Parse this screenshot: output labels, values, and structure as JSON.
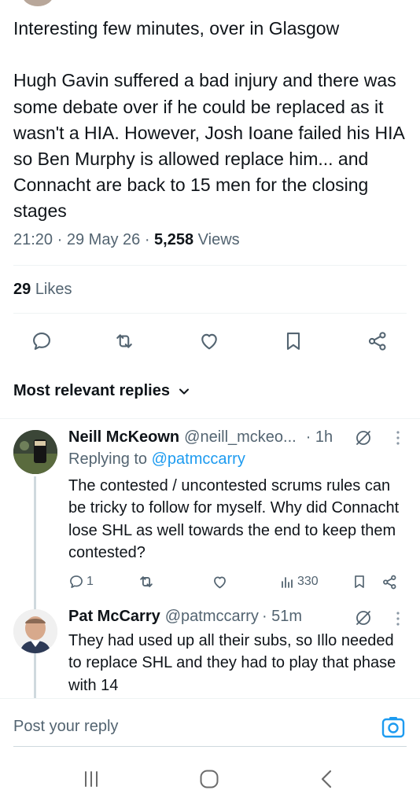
{
  "tweet": {
    "text": "Interesting few minutes, over in Glasgow\n\nHugh Gavin suffered a bad injury and there was some debate over if he could be replaced as it wasn't a HIA. However, Josh Ioane failed his HIA so Ben Murphy is allowed replace him... and Connacht are back to 15 men for the closing stages",
    "time": "21:20",
    "sep": "·",
    "date": "29 May 26",
    "views_count": "5,258",
    "views_label": "Views",
    "likes_count": "29",
    "likes_label": "Likes"
  },
  "actions": {
    "reply_icon": "reply-icon",
    "retweet_icon": "retweet-icon",
    "like_icon": "heart-icon",
    "bookmark_icon": "bookmark-icon",
    "share_icon": "share-icon"
  },
  "replies_sort": {
    "label": "Most relevant replies"
  },
  "replies": [
    {
      "name": "Neill McKeown",
      "handle": "@neill_mckeo...",
      "time": "· 1h",
      "replying_prefix": "Replying to",
      "replying_to": "@patmccarry",
      "text": "The contested / uncontested scrums rules can be tricky to follow for myself. Why did Connacht lose SHL as well towards the end to keep them contested?",
      "reply_count": "1",
      "views": "330"
    },
    {
      "name": "Pat McCarry",
      "handle": "@patmccarry",
      "time": "· 51m",
      "text": "They had used up all their subs, so Illo needed to replace SHL and they had to play that phase with 14"
    }
  ],
  "compose": {
    "placeholder": "Post your reply"
  },
  "colors": {
    "accent": "#1d9bf0",
    "text": "#0f1419",
    "secondary": "#536471",
    "border": "#eff3f4"
  }
}
